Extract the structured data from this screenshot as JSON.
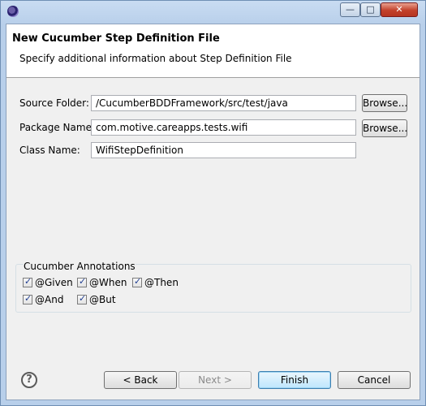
{
  "window": {
    "controls": {
      "minimize": "—",
      "maximize": "□",
      "close": "✕"
    },
    "icon": "eclipse-icon"
  },
  "header": {
    "title": "New Cucumber Step Definition File",
    "description": "Specify additional information about Step Definition File"
  },
  "form": {
    "source_folder": {
      "label": "Source Folder:",
      "value": "/CucumberBDDFramework/src/test/java",
      "browse": "Browse..."
    },
    "package_name": {
      "label": "Package Name:",
      "value": "com.motive.careapps.tests.wifi",
      "browse": "Browse..."
    },
    "class_name": {
      "label": "Class Name:",
      "value": "WifiStepDefinition"
    }
  },
  "annotations": {
    "title": "Cucumber Annotations",
    "items": [
      {
        "label": "@Given",
        "checked": true
      },
      {
        "label": "@When",
        "checked": true
      },
      {
        "label": "@Then",
        "checked": true
      },
      {
        "label": "@And",
        "checked": true
      },
      {
        "label": "@But",
        "checked": true
      }
    ]
  },
  "footer": {
    "help_icon": "question-icon",
    "help_glyph": "?",
    "back": "< Back",
    "next": "Next >",
    "finish": "Finish",
    "cancel": "Cancel"
  }
}
